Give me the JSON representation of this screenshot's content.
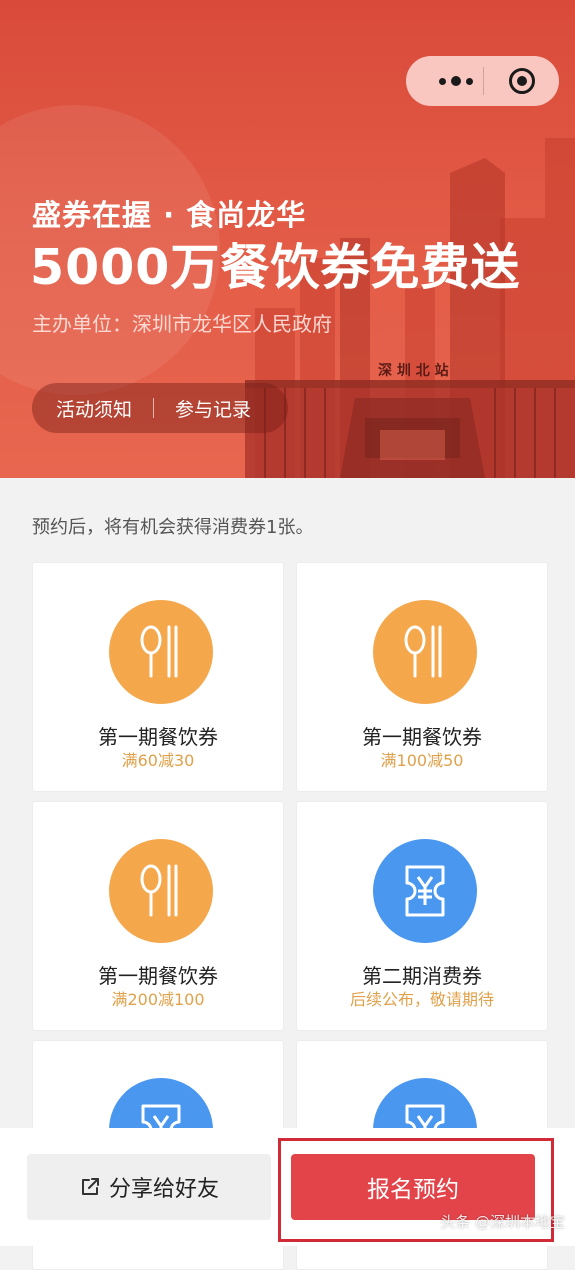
{
  "header": {
    "title_line1": "盛券在握 · 食尚龙华",
    "title_line2": "5000万餐饮券免费送",
    "organizer": "主办单位：深圳市龙华区人民政府",
    "station_sign": "深 圳 北 站",
    "tabs": [
      {
        "label": "活动须知"
      },
      {
        "label": "参与记录"
      }
    ]
  },
  "capsule": {
    "more_icon": "more-dots-icon",
    "close_icon": "target-close-icon"
  },
  "notice": "预约后，将有机会获得消费券1张。",
  "coupons": [
    {
      "name": "第一期餐饮券",
      "detail": "满60减30",
      "icon": "spoon-chopsticks-icon",
      "color": "#f5a74c"
    },
    {
      "name": "第一期餐饮券",
      "detail": "满100减50",
      "icon": "spoon-chopsticks-icon",
      "color": "#f5a74c"
    },
    {
      "name": "第一期餐饮券",
      "detail": "满200减100",
      "icon": "spoon-chopsticks-icon",
      "color": "#f5a74c"
    },
    {
      "name": "第二期消费券",
      "detail": "后续公布，敬请期待",
      "icon": "yen-ticket-icon",
      "color": "#4a97f0"
    },
    {
      "name": "",
      "detail": "",
      "icon": "yen-ticket-icon",
      "color": "#4a97f0"
    },
    {
      "name": "",
      "detail": "",
      "icon": "yen-ticket-icon",
      "color": "#4a97f0"
    }
  ],
  "footer": {
    "share_label": "分享给好友",
    "reserve_label": "报名预约"
  },
  "watermark": "头条 @深圳本地宝",
  "colors": {
    "banner_red": "#e25a45",
    "accent_orange": "#f5a74c",
    "accent_blue": "#4a97f0",
    "reserve_red": "#e2444a",
    "highlight_border": "#cf2a35"
  }
}
